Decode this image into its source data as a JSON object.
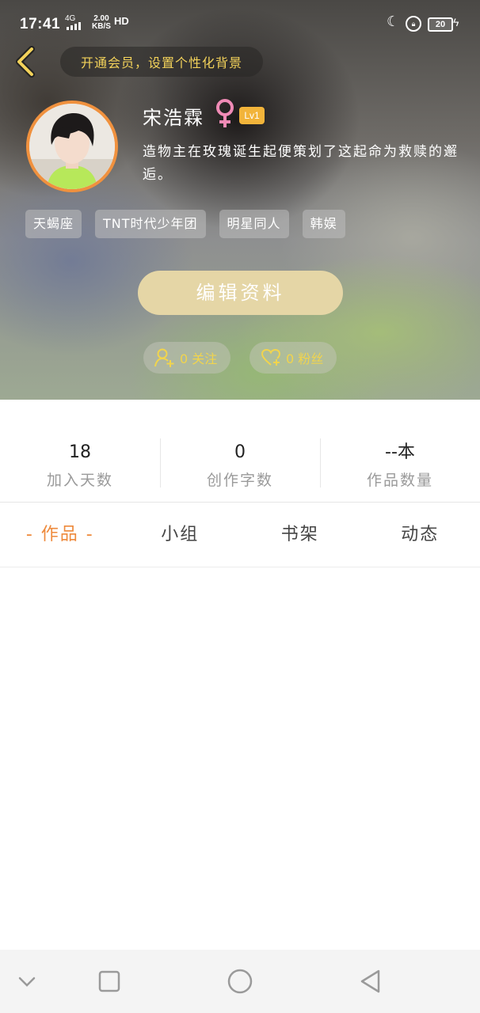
{
  "status_bar": {
    "time": "17:41",
    "network": "4G",
    "speed_value": "2.00",
    "speed_unit": "KB/S",
    "hd": "HD",
    "battery": "20"
  },
  "header": {
    "vip_prompt": "开通会员，设置个性化背景",
    "username": "宋浩霖",
    "gender_symbol": "♀",
    "level": "Lv1",
    "bio": "造物主在玫瑰诞生起便策划了这起命为救赎的邂逅。",
    "tags": [
      "天蝎座",
      "TNT时代少年团",
      "明星同人",
      "韩娱"
    ],
    "edit_button": "编辑资料",
    "follow_label": "0 关注",
    "fans_label": "0 粉丝"
  },
  "stats": [
    {
      "value": "18",
      "label": "加入天数"
    },
    {
      "value": "0",
      "label": "创作字数"
    },
    {
      "value": "--本",
      "label": "作品数量"
    }
  ],
  "tabs": [
    {
      "label": "- 作品 -",
      "active": true
    },
    {
      "label": "小组",
      "active": false
    },
    {
      "label": "书架",
      "active": false
    },
    {
      "label": "动态",
      "active": false
    }
  ],
  "colors": {
    "accent": "#ee8a3c",
    "gold": "#f1d44d",
    "edit_button": "#e5d6a6",
    "avatar_border": "#f0913e",
    "level_badge": "#f2b43a"
  },
  "icons": [
    "back-icon",
    "gender-female-icon",
    "add-user-icon",
    "heart-icon",
    "nav-down-icon",
    "nav-recent-icon",
    "nav-home-icon",
    "nav-back-icon"
  ]
}
